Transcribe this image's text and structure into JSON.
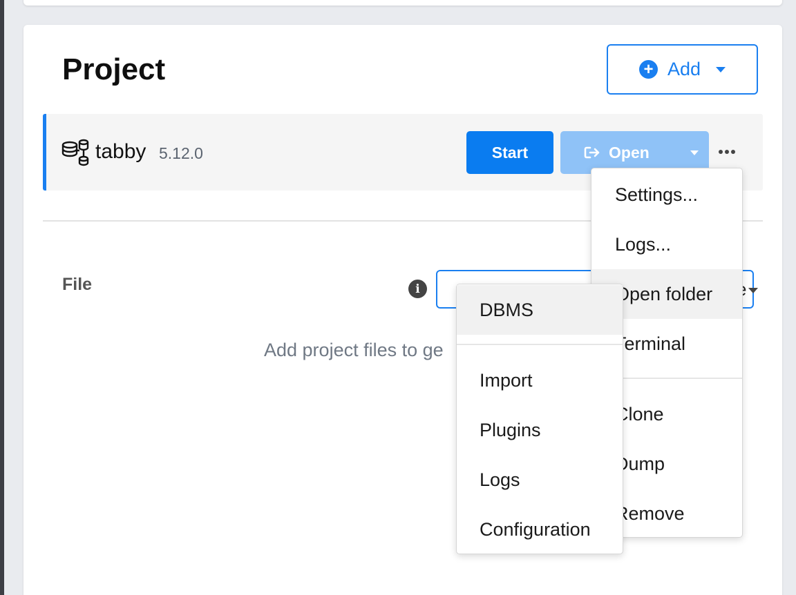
{
  "page": {
    "title": "Project"
  },
  "header": {
    "add_button": {
      "label": "Add",
      "icon": "plus-circle-icon"
    }
  },
  "project": {
    "name": "tabby",
    "version": "5.12.0",
    "icon": "database-cluster-icon",
    "start_label": "Start",
    "open_label": "Open",
    "open_icon": "sign-out-icon",
    "more_icon": "ellipsis-icon"
  },
  "file_section": {
    "label": "File",
    "info_icon": "info-icon",
    "select_tail": "e",
    "empty_message": "Add project files to ge"
  },
  "more_menu": {
    "items": [
      {
        "label": "Settings..."
      },
      {
        "label": "Logs..."
      },
      {
        "label": "Open folder"
      },
      {
        "label": "Terminal"
      },
      {
        "label": "Clone"
      },
      {
        "label": "Dump"
      },
      {
        "label": "Remove"
      }
    ]
  },
  "add_menu": {
    "items": [
      {
        "label": "DBMS"
      },
      {
        "label": "Import"
      },
      {
        "label": "Plugins"
      },
      {
        "label": "Logs"
      },
      {
        "label": "Configuration"
      }
    ]
  },
  "colors": {
    "accent": "#1a7ff0",
    "open_disabled": "#8fc2f7",
    "row_highlight": "#f5f5f5"
  }
}
